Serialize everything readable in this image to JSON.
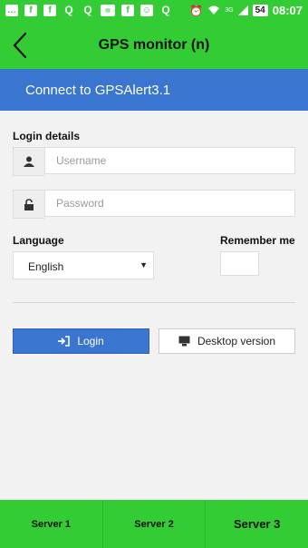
{
  "status_bar": {
    "icons": [
      "chat-icon",
      "facebook-icon",
      "facebook-icon",
      "q-icon",
      "q-icon",
      "news-icon",
      "facebook-icon",
      "emoji-icon",
      "q-icon"
    ],
    "right_icons": [
      "alarm-icon",
      "wifi-icon",
      "signal-icon"
    ],
    "network": "3G",
    "battery": "54",
    "time": "08:07"
  },
  "app_bar": {
    "title": "GPS monitor (n)"
  },
  "banner": {
    "text": "Connect to GPSAlert3.1"
  },
  "form": {
    "login_details_label": "Login details",
    "username_placeholder": "Username",
    "password_placeholder": "Password",
    "language_label": "Language",
    "language_value": "English",
    "remember_label": "Remember me",
    "login_button": "Login",
    "desktop_button": "Desktop version"
  },
  "bottom_tabs": [
    {
      "label": "Server 1"
    },
    {
      "label": "Server 2"
    },
    {
      "label": "Server 3"
    }
  ],
  "colors": {
    "green": "#34cc34",
    "blue": "#3a76cf",
    "background": "#f2f2f2"
  }
}
